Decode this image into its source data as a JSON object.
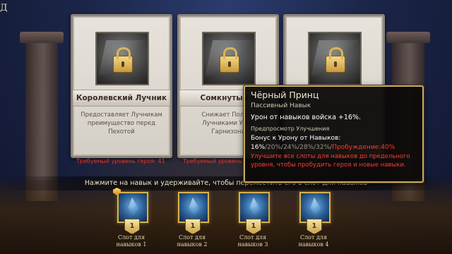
{
  "top_left_text": "Д",
  "cards": [
    {
      "title": "Королевский Лучник",
      "description": "Предоставляет Лучникам преимущество перед Пехотой",
      "requirement": "Требуемый уровень героя: 41"
    },
    {
      "title": "Сомкнутый С",
      "description": "Снижает Получа Лучниками Урон Гарнизона",
      "requirement": "Требуемый уровень"
    },
    {
      "title": "",
      "description": "",
      "requirement": ""
    }
  ],
  "hint": "Нажмите на навык и удерживайте, чтобы переместить его в слот для навыков",
  "slots": [
    {
      "level": "1",
      "label": "Слот для навыков 1"
    },
    {
      "level": "1",
      "label": "Слот для навыков 2"
    },
    {
      "level": "1",
      "label": "Слот для навыков 3"
    },
    {
      "level": "1",
      "label": "Слот для навыков 4"
    }
  ],
  "tooltip": {
    "title": "Чёрный Принц",
    "type": "Пассивный Навык",
    "effect": "Урон от навыков войска +16%.",
    "preview_heading": "Предпросмотр Улучшения",
    "bonus_label": "Бонус к Урону от Навыков:",
    "value_current": "16%",
    "value_rest": "/20%/24%/28%/32%/",
    "value_awaken": "Пробуждение:40%",
    "warning": "Улучшите все слоты для навыков до предельного уровня, чтобы пробудить героя и новые навыки."
  },
  "colors": {
    "gold_border": "#c9a85a",
    "warning_red": "#ff3b2a",
    "requirement_red": "#e23b2e"
  }
}
